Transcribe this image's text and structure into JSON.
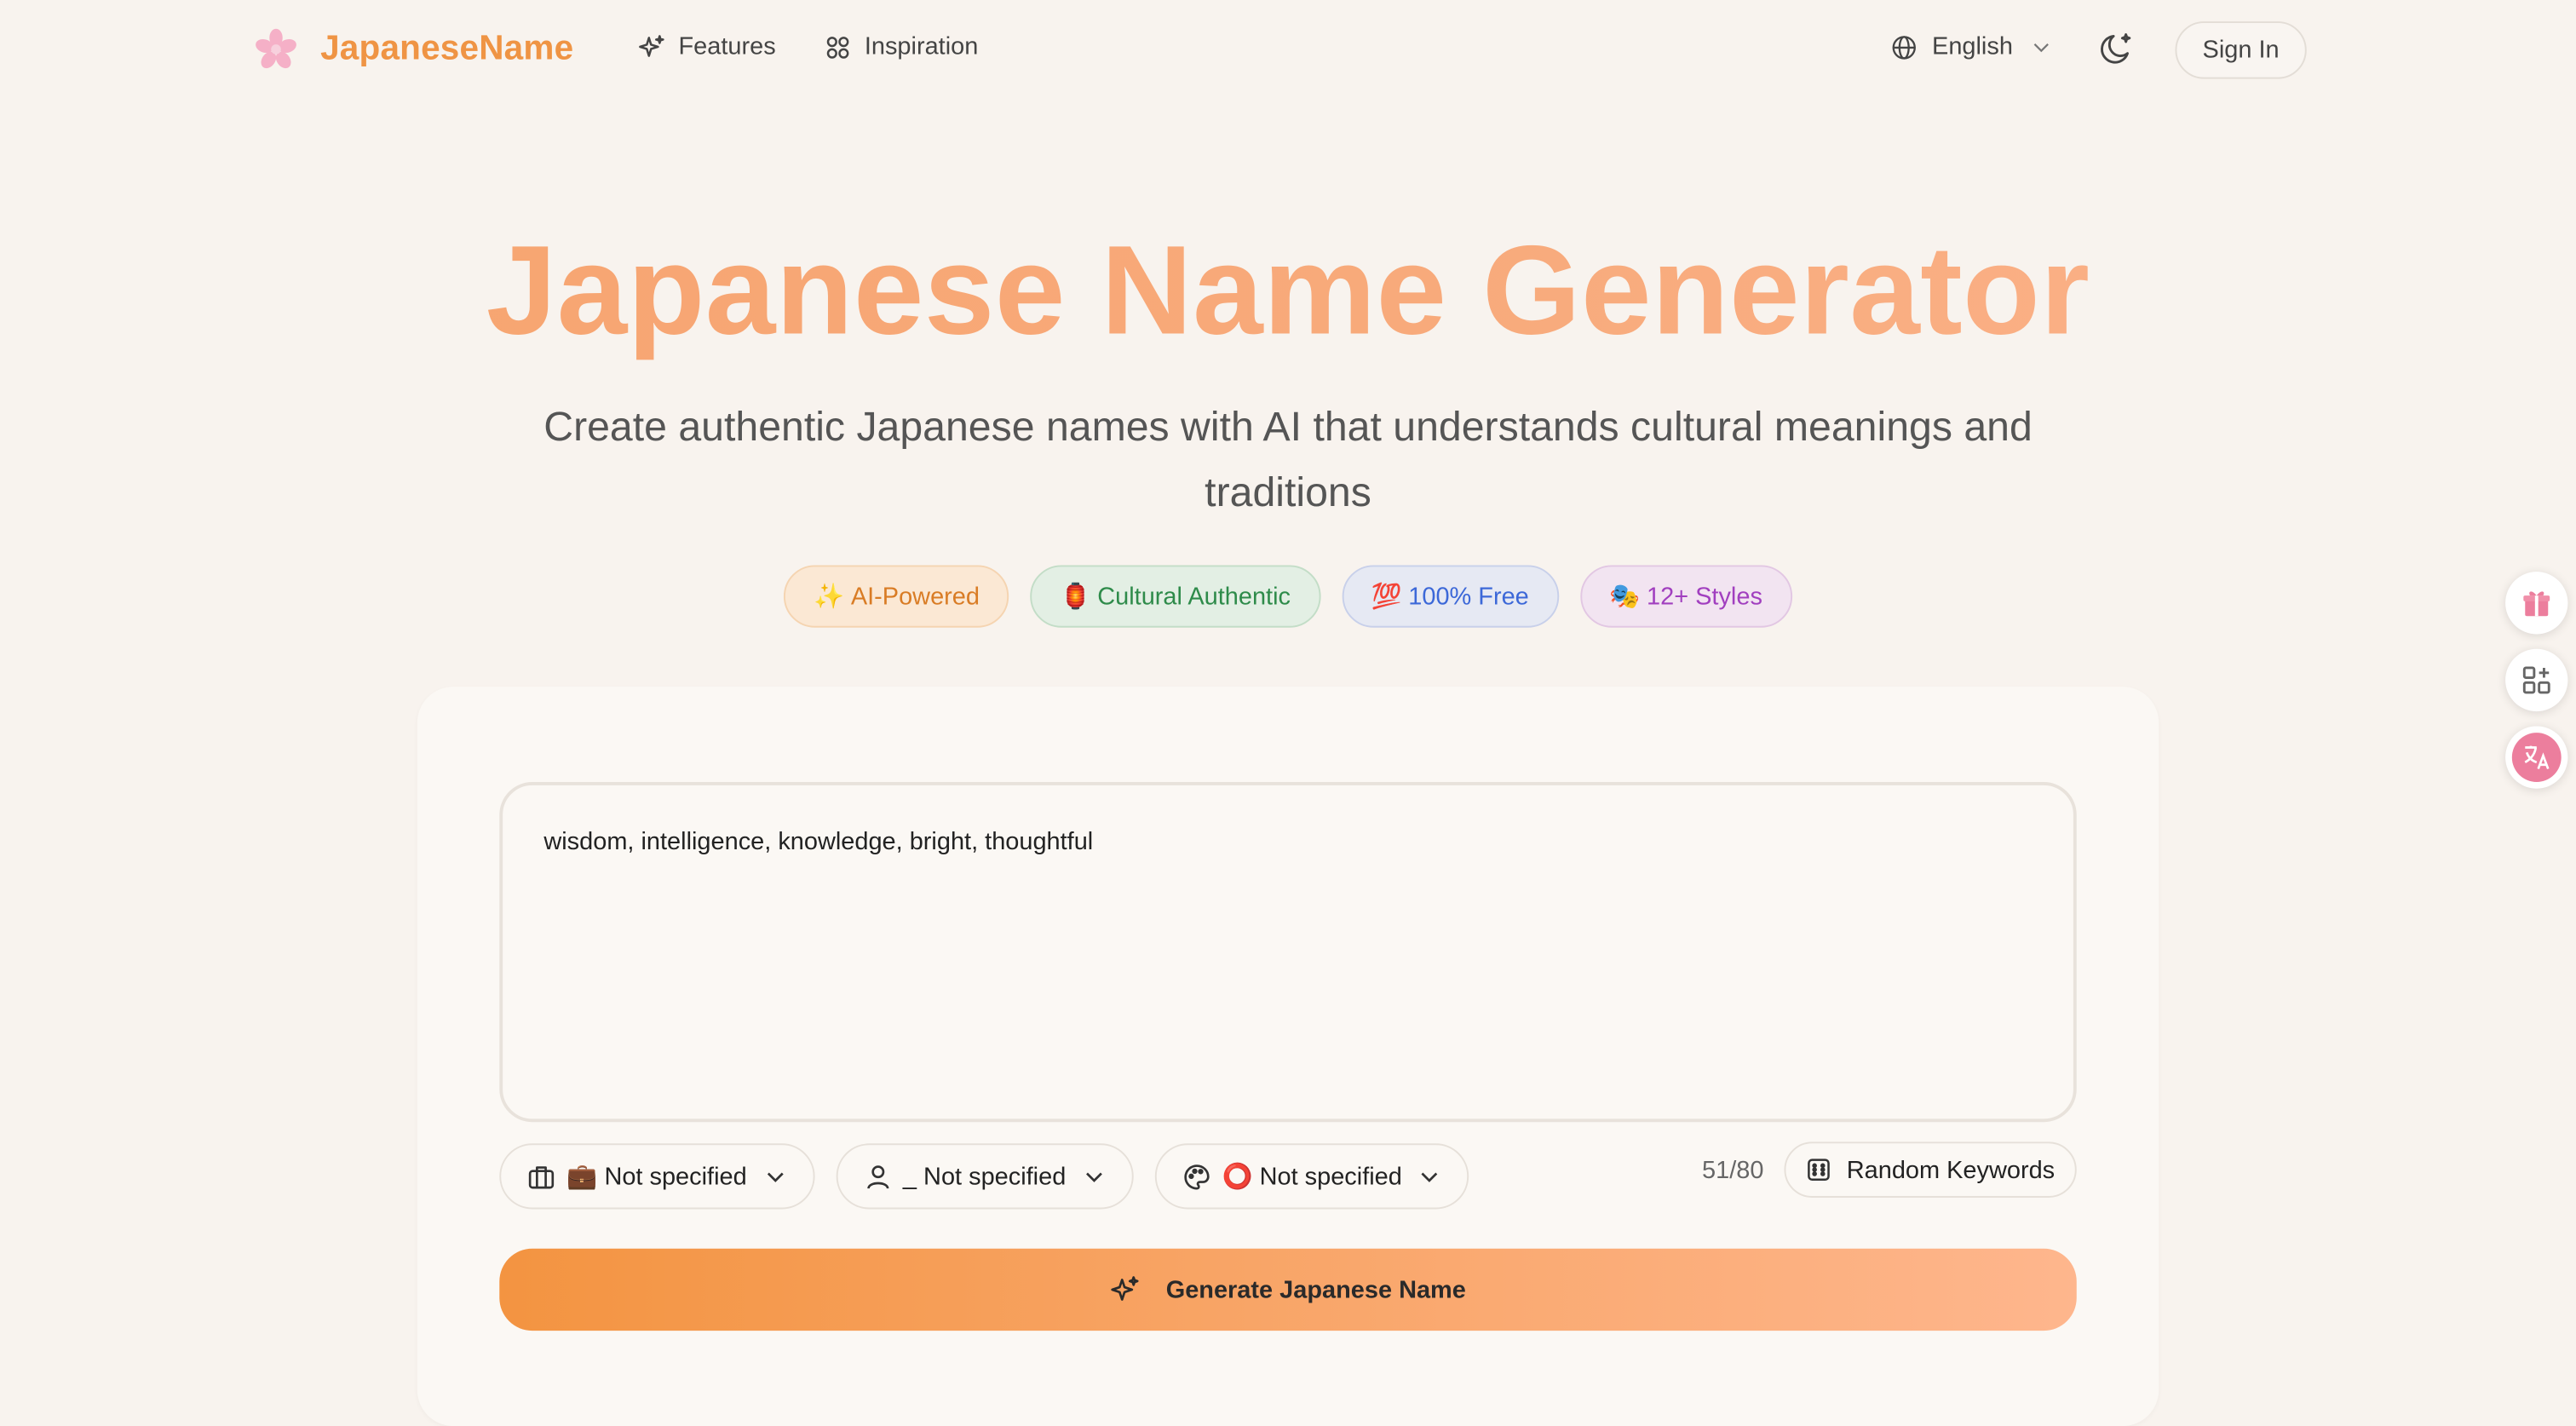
{
  "header": {
    "brand": "JapaneseName",
    "nav": [
      {
        "label": "Features",
        "icon": "sparkles-icon"
      },
      {
        "label": "Inspiration",
        "icon": "grid-icon"
      }
    ],
    "language": "English",
    "sign_in": "Sign In"
  },
  "hero": {
    "title": "Japanese Name Generator",
    "subtitle": "Create authentic Japanese names with AI that understands cultural meanings and traditions",
    "badges": [
      {
        "emoji": "✨",
        "label": "AI-Powered"
      },
      {
        "emoji": "🏮",
        "label": "Cultural Authentic"
      },
      {
        "emoji": "💯",
        "label": "100% Free"
      },
      {
        "emoji": "🎭",
        "label": "12+ Styles"
      }
    ]
  },
  "form": {
    "keywords_value": "wisdom, intelligence, knowledge, bright, thoughtful",
    "selects": [
      {
        "icon": "briefcase-icon",
        "emoji": "💼",
        "value": "Not specified"
      },
      {
        "icon": "user-icon",
        "emoji": "_",
        "value": "Not specified"
      },
      {
        "icon": "palette-icon",
        "emoji": "⭕",
        "value": "Not specified"
      }
    ],
    "char_count": "51/80",
    "random_keywords": "Random Keywords",
    "generate": "Generate Japanese Name"
  },
  "colors": {
    "accent": "#ef9444",
    "background": "#f8f3ee",
    "gradient_start": "#f39441",
    "gradient_end": "#feb68d"
  }
}
